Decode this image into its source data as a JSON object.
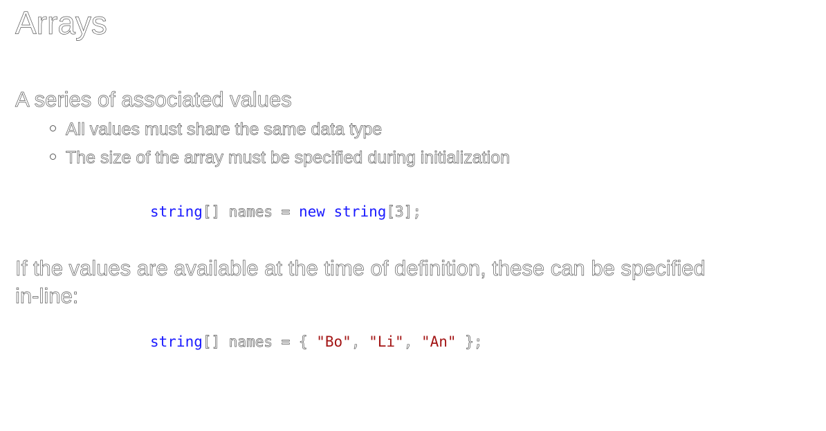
{
  "slide": {
    "title": "Arrays",
    "subtitle": "A series of associated values",
    "bullets": [
      "All values must share the same data type",
      "The size of the array must be specified during initialization"
    ],
    "code1": {
      "kw1": "string",
      "p1": "[] names = ",
      "kw2": "new",
      "kw3": " string",
      "p2": "[3];"
    },
    "paragraph": "If the values are available at the time of definition, these can be specified in-line:",
    "code2": {
      "kw1": "string",
      "p1": "[] names = { ",
      "s1": "\"Bo\"",
      "c1": ", ",
      "s2": "\"Li\"",
      "c2": ", ",
      "s3": "\"An\"",
      "p2": " };"
    }
  }
}
